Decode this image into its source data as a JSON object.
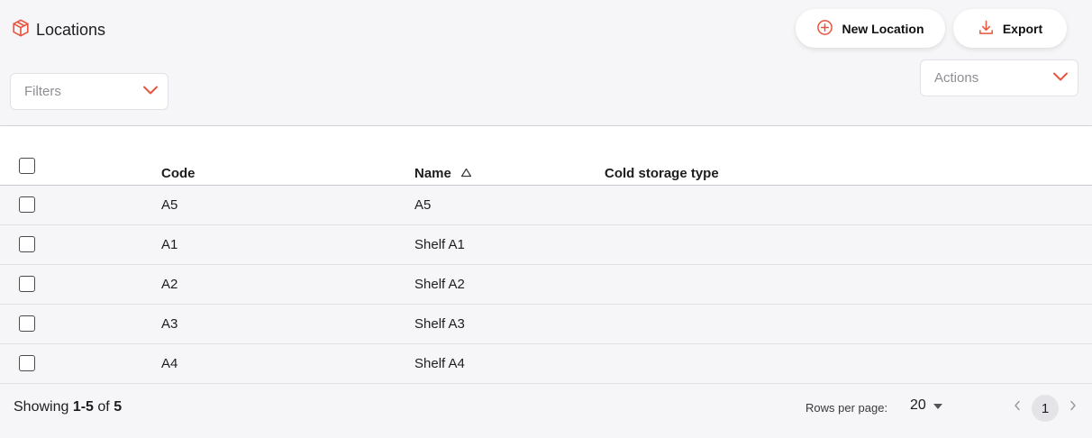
{
  "header": {
    "title": "Locations",
    "new_location_label": "New Location",
    "export_label": "Export",
    "filters_placeholder": "Filters",
    "actions_placeholder": "Actions"
  },
  "colors": {
    "accent": "#e8553e",
    "row_bg": "#f6f6f8",
    "border": "#e2e2e6"
  },
  "table": {
    "columns": [
      "Code",
      "Name",
      "Cold storage type"
    ],
    "sorted_column": "Name",
    "sort_direction": "ascending",
    "rows": [
      {
        "code": "A5",
        "name": "A5",
        "cold_storage_type": ""
      },
      {
        "code": "A1",
        "name": "Shelf A1",
        "cold_storage_type": ""
      },
      {
        "code": "A2",
        "name": "Shelf A2",
        "cold_storage_type": ""
      },
      {
        "code": "A3",
        "name": "Shelf A3",
        "cold_storage_type": ""
      },
      {
        "code": "A4",
        "name": "Shelf A4",
        "cold_storage_type": ""
      }
    ]
  },
  "footer": {
    "showing_prefix": "Showing",
    "showing_range": "1-5",
    "showing_of": "of",
    "showing_total": "5",
    "rows_per_page_label": "Rows per page:",
    "rows_per_page_value": "20",
    "current_page": "1"
  }
}
